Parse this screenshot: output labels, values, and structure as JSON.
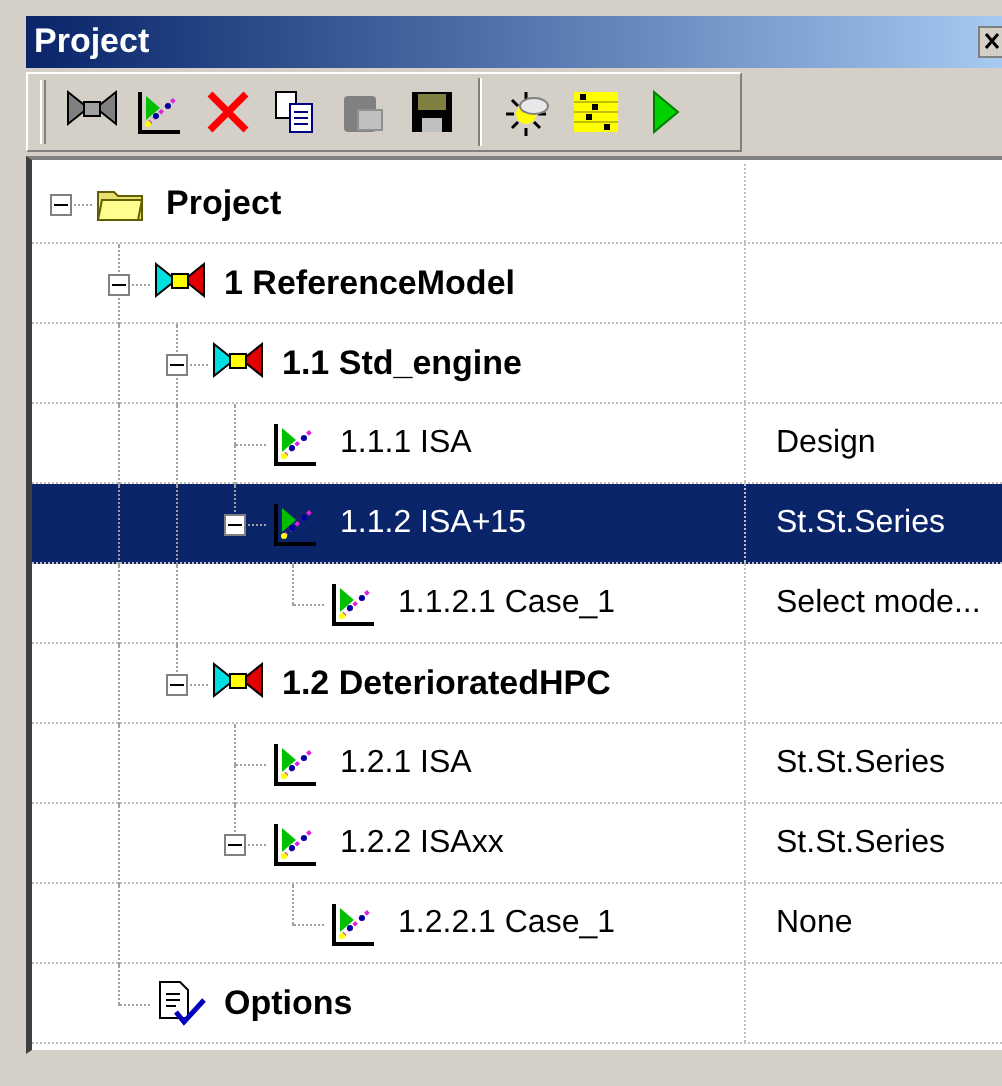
{
  "window": {
    "title": "Project"
  },
  "toolbar": [
    {
      "kind": "model",
      "disabled": true
    },
    {
      "kind": "chart",
      "disabled": false
    },
    {
      "kind": "delete",
      "disabled": false
    },
    {
      "kind": "copy",
      "disabled": false
    },
    {
      "kind": "paste",
      "disabled": true
    },
    {
      "kind": "save",
      "disabled": false
    },
    {
      "kind": "separator"
    },
    {
      "kind": "sun",
      "disabled": false
    },
    {
      "kind": "grid",
      "disabled": false
    },
    {
      "kind": "run",
      "disabled": false
    }
  ],
  "tree": [
    {
      "label": "Project",
      "kind": "folder",
      "bold": true,
      "expanded": true,
      "selected": false,
      "children": [
        {
          "label": "1 ReferenceModel",
          "kind": "model",
          "bold": true,
          "expanded": true,
          "selected": false,
          "children": [
            {
              "label": "1.1 Std_engine",
              "kind": "model",
              "bold": true,
              "expanded": true,
              "selected": false,
              "children": [
                {
                  "label": "1.1.1 ISA",
                  "value": "Design",
                  "kind": "case",
                  "bold": false,
                  "selected": false
                },
                {
                  "label": "1.1.2 ISA+15",
                  "value": "St.St.Series",
                  "kind": "case",
                  "bold": false,
                  "expanded": true,
                  "selected": true,
                  "children": [
                    {
                      "label": "1.1.2.1 Case_1",
                      "value": "Select mode...",
                      "kind": "case",
                      "bold": false,
                      "selected": false
                    }
                  ]
                }
              ]
            },
            {
              "label": "1.2 DeterioratedHPC",
              "kind": "model",
              "bold": true,
              "expanded": true,
              "selected": false,
              "children": [
                {
                  "label": "1.2.1 ISA",
                  "value": "St.St.Series",
                  "kind": "case",
                  "bold": false,
                  "selected": false
                },
                {
                  "label": "1.2.2 ISAxx",
                  "value": "St.St.Series",
                  "kind": "case",
                  "bold": false,
                  "expanded": true,
                  "selected": false,
                  "children": [
                    {
                      "label": "1.2.2.1 Case_1",
                      "value": "None",
                      "kind": "case",
                      "bold": false,
                      "selected": false
                    }
                  ]
                }
              ]
            }
          ]
        },
        {
          "label": "Options",
          "kind": "options",
          "bold": true,
          "selected": false
        }
      ]
    }
  ]
}
